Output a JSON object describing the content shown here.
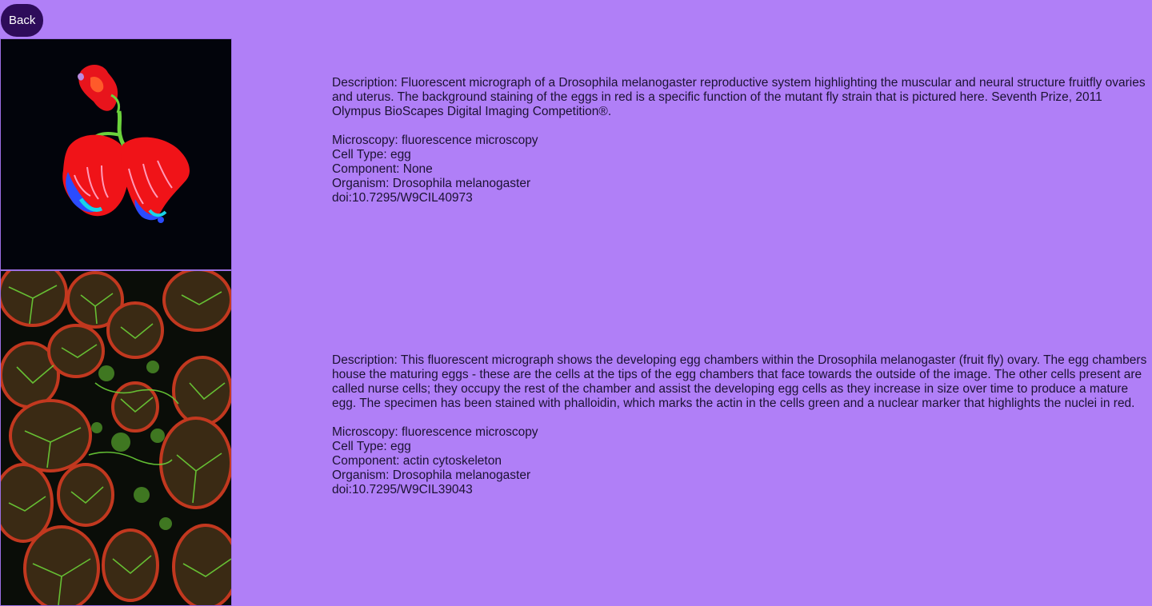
{
  "nav": {
    "back_label": "Back"
  },
  "entries": [
    {
      "description": "Description: Fluorescent micrograph of a Drosophila melanogaster reproductive system highlighting the muscular and neural structure fruitfly ovaries and uterus. The background staining of the eggs in red is a specific function of the mutant fly strain that is pictured here. Seventh Prize, 2011 Olympus BioScapes Digital Imaging Competition®.",
      "microscopy": "Microscopy: fluorescence microscopy",
      "cell_type": "Cell Type: egg",
      "component": "Component: None",
      "organism": "Organism: Drosophila melanogaster",
      "doi": "doi:10.7295/W9CIL40973"
    },
    {
      "description": "Description: This fluorescent micrograph shows the developing egg chambers within the Drosophila melanogaster (fruit fly) ovary. The egg chambers house the maturing eggs - these are the cells at the tips of the egg chambers that face towards the outside of the image. The other cells present are called nurse cells; they occupy the rest of the chamber and assist the developing egg cells as they increase in size over time to produce a mature egg. The specimen has been stained with phalloidin, which marks the actin in the cells green and a nuclear marker that highlights the nuclei in red.",
      "microscopy": "Microscopy: fluorescence microscopy",
      "cell_type": "Cell Type: egg",
      "component": "Component: actin cytoskeleton",
      "organism": "Organism: Drosophila melanogaster",
      "doi": "doi:10.7295/W9CIL39043"
    }
  ],
  "colors": {
    "page_background": "#b07ff7",
    "back_button": "#2e0c5a",
    "image_background": "#02040b",
    "stain_red": "#ff1a1a",
    "stain_green": "#5fd13a",
    "stain_blue": "#2a4cff"
  }
}
